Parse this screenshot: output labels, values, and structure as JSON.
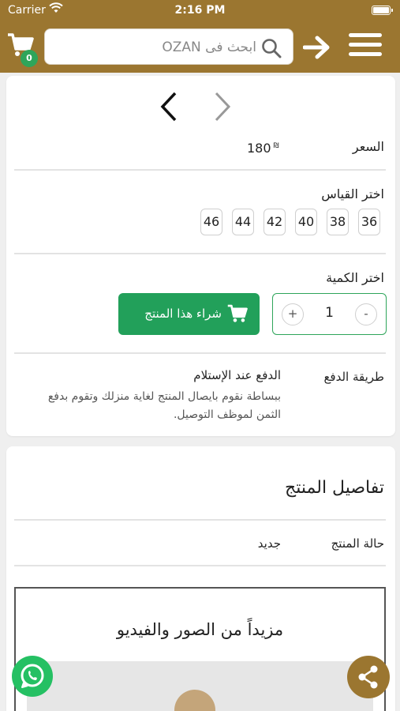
{
  "status_bar": {
    "carrier": "Carrier",
    "time": "2:16 PM"
  },
  "header": {
    "cart_count": "0",
    "search_placeholder": "ابحث فى OZAN",
    "icons": {
      "cart": "cart-icon",
      "search": "search-icon",
      "back": "arrow-right-icon",
      "menu": "hamburger-menu-icon"
    }
  },
  "product": {
    "price_label": "السعر",
    "price_value": "180",
    "currency_symbol": "₪",
    "size_label": "اختر القياس",
    "sizes": [
      "36",
      "38",
      "40",
      "42",
      "44",
      "46"
    ],
    "quantity_label": "اختر الكمية",
    "quantity": "1",
    "minus": "-",
    "plus": "+",
    "buy_label": "شراء هذا المنتج",
    "payment_label": "طريقة الدفع",
    "payment_title": "الدفع عند الإستلام",
    "payment_desc": "ببساطة نقوم بايصال المنتج لغاية منزلك وتقوم بدفع الثمن لموظف التوصيل."
  },
  "details": {
    "title": "تفاصيل المنتج",
    "condition_label": "حالة المنتج",
    "condition_value": "جديد",
    "media_title": "مزيداً من الصور والفيديو"
  },
  "colors": {
    "brand": "#9b7630",
    "accent_green": "#22a05a",
    "whatsapp": "#25c063"
  },
  "floating": {
    "whatsapp_icon": "whatsapp-icon",
    "share_icon": "share-icon"
  }
}
